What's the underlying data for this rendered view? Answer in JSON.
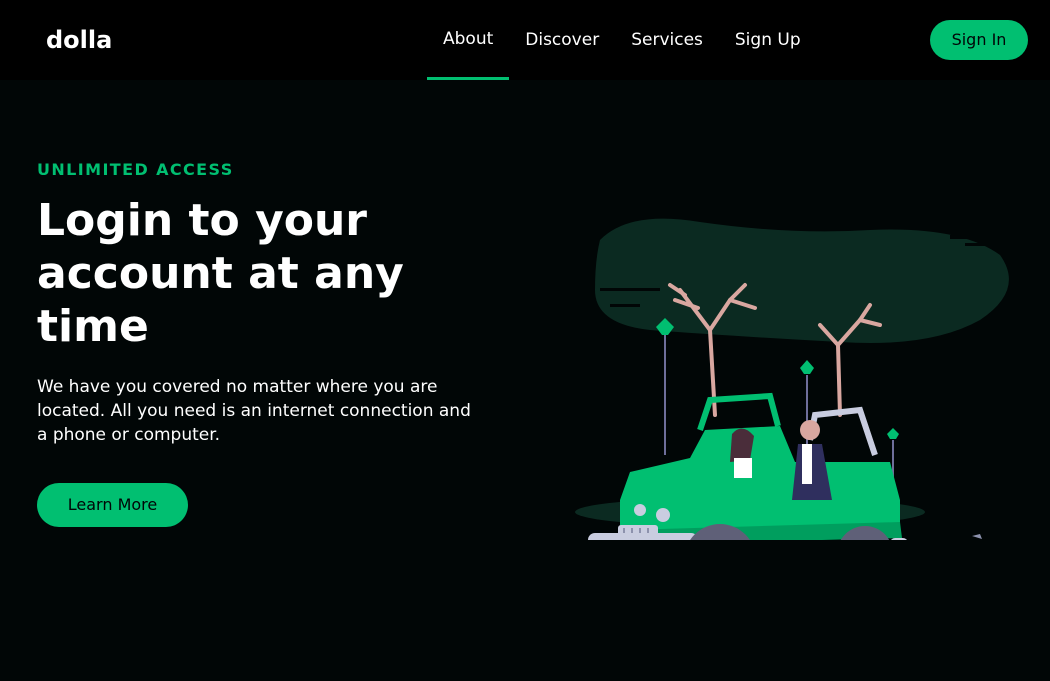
{
  "navbar": {
    "logo": "dolla",
    "links": [
      {
        "label": "About",
        "active": true
      },
      {
        "label": "Discover",
        "active": false
      },
      {
        "label": "Services",
        "active": false
      },
      {
        "label": "Sign Up",
        "active": false
      }
    ],
    "signin_label": "Sign In"
  },
  "hero": {
    "top_line": "Unlimited Access",
    "heading": "Login to your account at any time",
    "subtitle": "We have you covered no matter where you are located. All you need is an internet connection and a phone or computer.",
    "button_label": "Learn More",
    "illustration_icon": "car-illustration"
  },
  "colors": {
    "accent": "#01bf71",
    "background": "#010606",
    "navbar": "#000000",
    "text": "#ffffff"
  }
}
